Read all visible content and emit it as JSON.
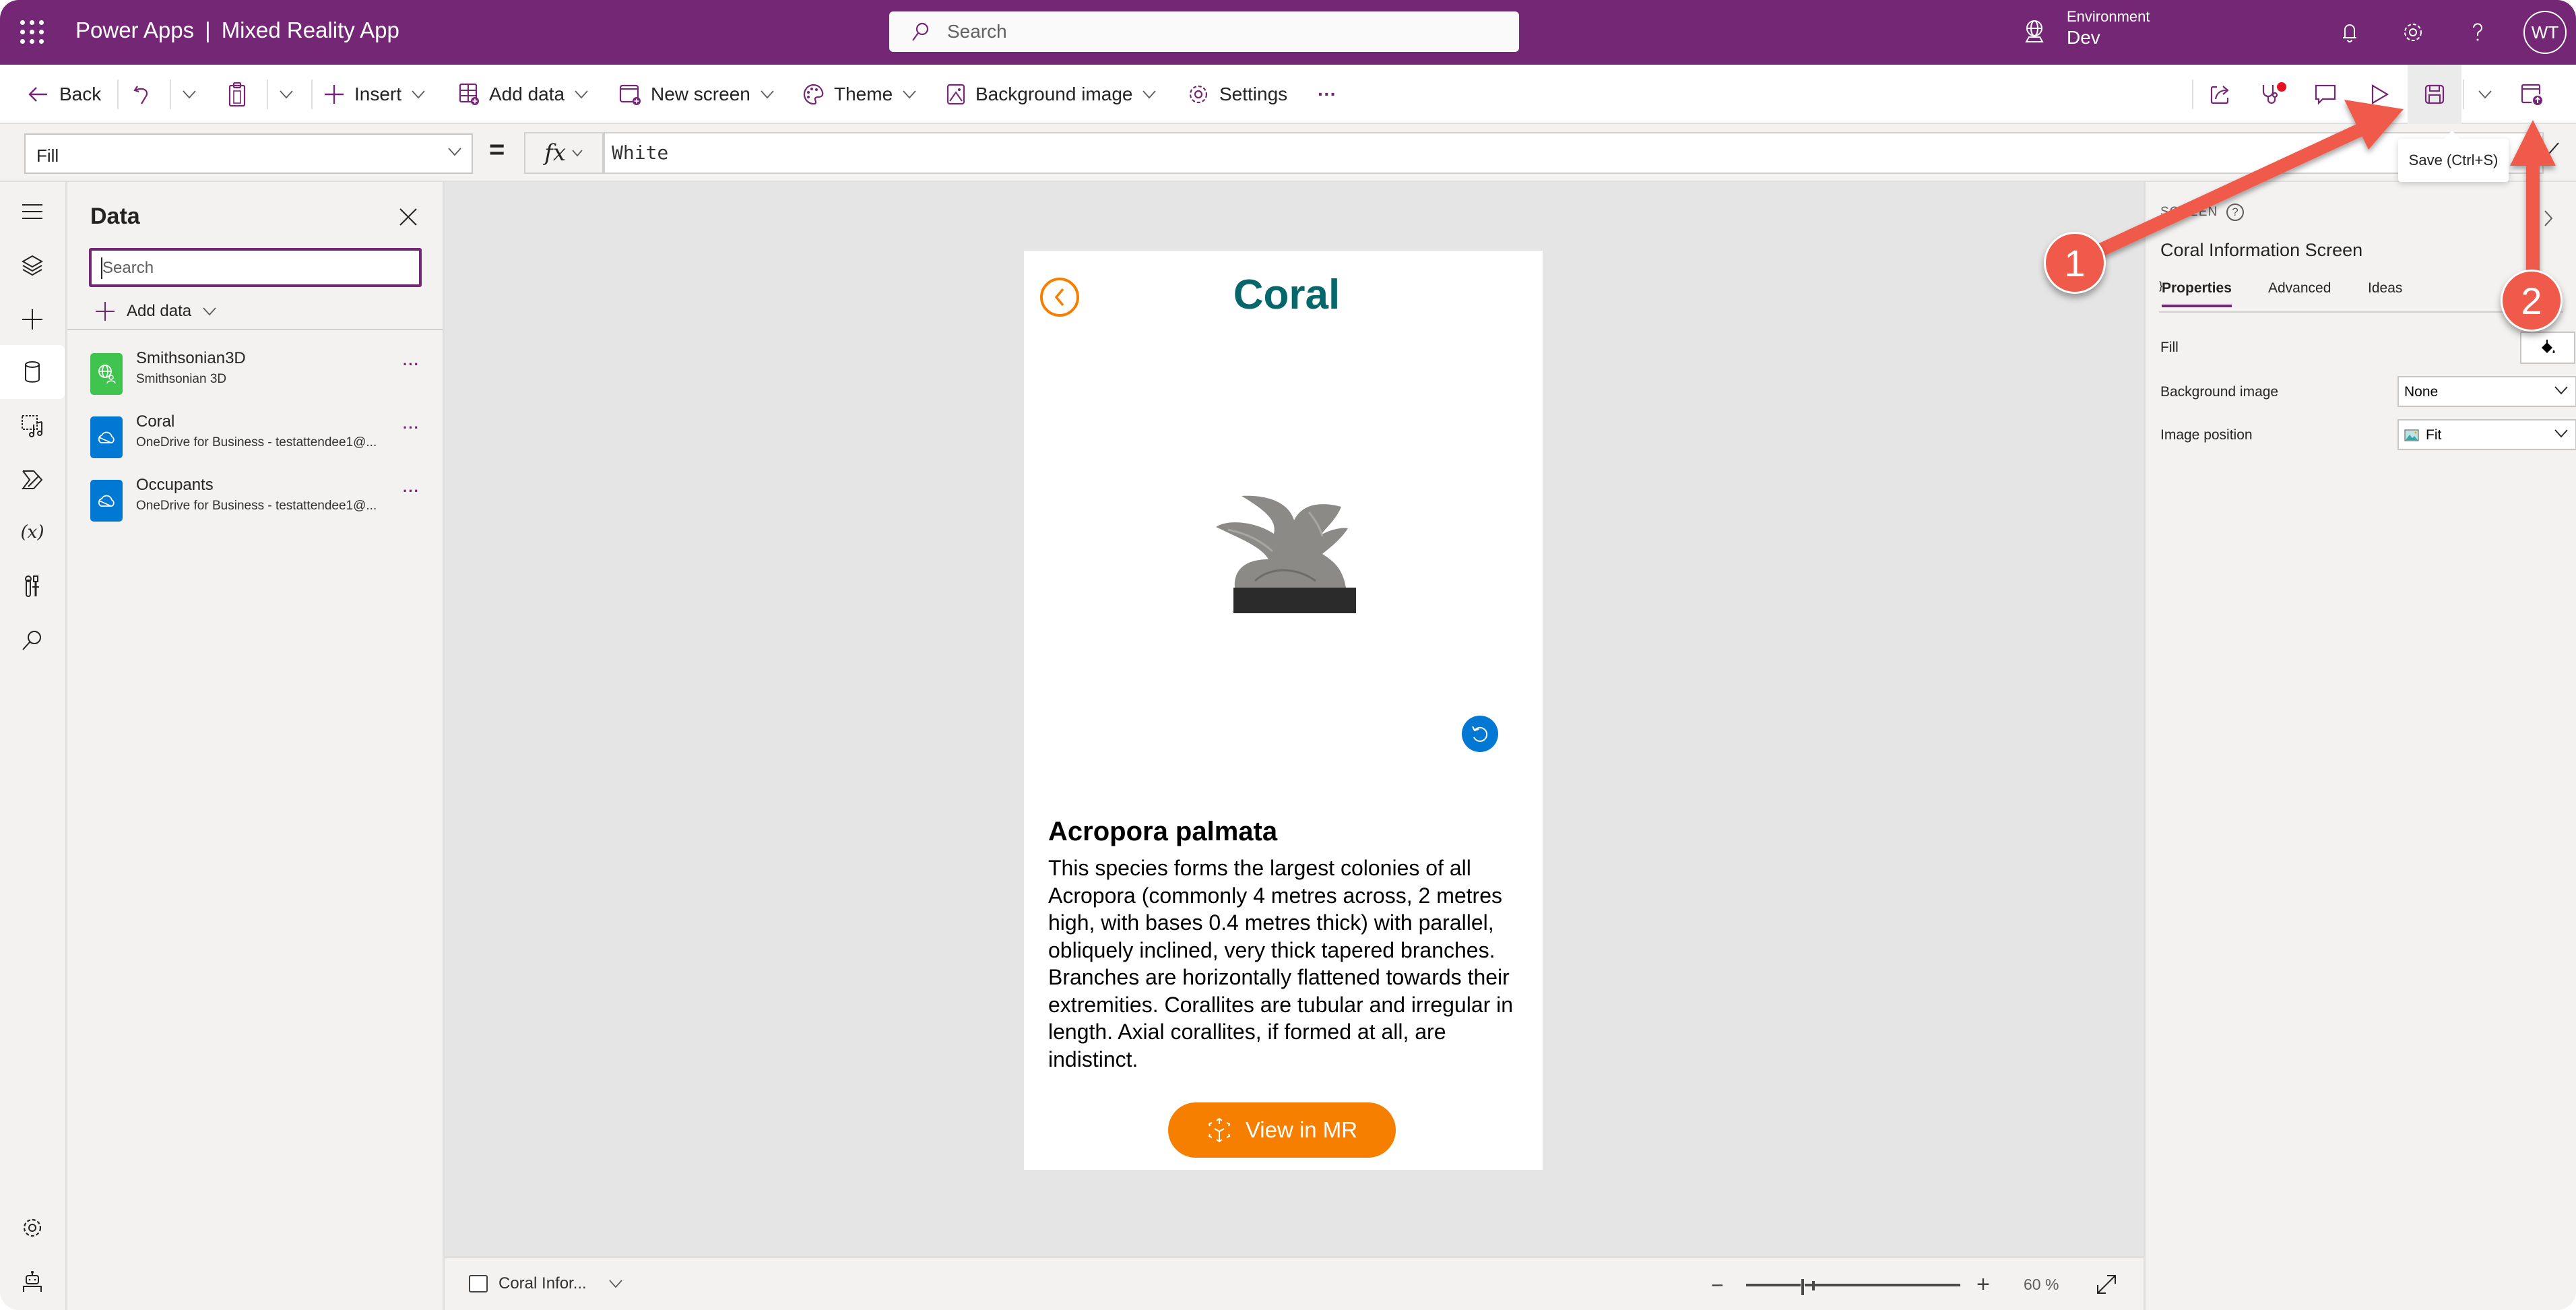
{
  "header": {
    "product": "Power Apps",
    "separator": "|",
    "app_name": "Mixed Reality App",
    "search_placeholder": "Search",
    "environment_label": "Environment",
    "environment_value": "Dev",
    "avatar_initials": "WT"
  },
  "command_bar": {
    "back": "Back",
    "insert": "Insert",
    "add_data": "Add data",
    "new_screen": "New screen",
    "theme": "Theme",
    "background_image": "Background image",
    "settings": "Settings",
    "more": "···"
  },
  "tooltip": {
    "save": "Save (Ctrl+S)"
  },
  "formula_bar": {
    "property": "Fill",
    "equals": "=",
    "fx": "fx",
    "formula": "White"
  },
  "data_panel": {
    "title": "Data",
    "search_placeholder": "Search",
    "add_data": "Add data",
    "sources": [
      {
        "name": "Smithsonian3D",
        "subtitle": "Smithsonian 3D",
        "icon": "globe-person-icon",
        "color": "#3fc44f"
      },
      {
        "name": "Coral",
        "subtitle": "OneDrive for Business - testattendee1@...",
        "icon": "onedrive-icon",
        "color": "#0078d4"
      },
      {
        "name": "Occupants",
        "subtitle": "OneDrive for Business - testattendee1@...",
        "icon": "onedrive-icon",
        "color": "#0078d4"
      }
    ],
    "more": "···"
  },
  "app_screen": {
    "title": "Coral",
    "species": "Acropora palmata",
    "description": "This species forms the largest colonies of all Acropora (commonly 4 metres across, 2 metres high, with bases 0.4 metres thick) with parallel, obliquely inclined, very thick tapered branches. Branches are horizontally flattened towards their extremities. Corallites are tubular and irregular in length. Axial corallites, if formed at all, are indistinct.",
    "mr_button": "View in MR",
    "accent": "#f77f00",
    "title_color": "#05676b"
  },
  "status_bar": {
    "screen_name": "Coral Infor...",
    "zoom_minus": "−",
    "zoom_plus": "+",
    "zoom_percent": 60,
    "zoom_label": "60  %"
  },
  "properties_panel": {
    "kind": "SCREEN",
    "name": "Coral Information Screen",
    "tabs": [
      "Properties",
      "Advanced",
      "Ideas"
    ],
    "active_tab": "Properties",
    "rows": {
      "fill_label": "Fill",
      "background_image_label": "Background image",
      "background_image_value": "None",
      "image_position_label": "Image position",
      "image_position_value": "Fit"
    }
  },
  "annotations": [
    {
      "number": "1",
      "target": "save-button"
    },
    {
      "number": "2",
      "target": "publish-button"
    }
  ],
  "colors": {
    "brand": "#742774",
    "annotation": "#f05a4b"
  }
}
